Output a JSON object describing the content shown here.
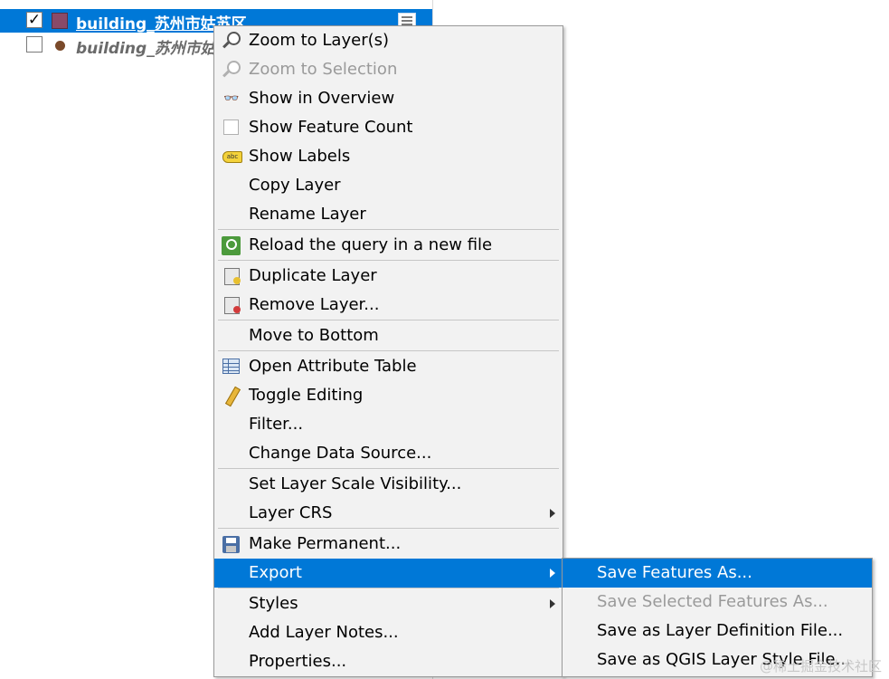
{
  "layers": [
    {
      "name": "building_苏州市姑苏区",
      "checked": true,
      "selected": true
    },
    {
      "name": "building_苏州市姑",
      "checked": false,
      "selected": false
    }
  ],
  "check_glyph": "✓",
  "menu": {
    "items": [
      {
        "label": "Zoom to Layer(s)",
        "icon": "zoom-icon"
      },
      {
        "label": "Zoom to Selection",
        "icon": "zoom-icon",
        "disabled": true
      },
      {
        "label": "Show in Overview",
        "icon": "overview-icon"
      },
      {
        "label": "Show Feature Count",
        "icon": "checkbox-icon"
      },
      {
        "label": "Show Labels",
        "icon": "labels-icon"
      },
      {
        "label": "Copy Layer"
      },
      {
        "label": "Rename Layer"
      },
      {
        "label": "Reload the query in a new file",
        "icon": "reload-query-icon"
      },
      {
        "label": "Duplicate Layer",
        "icon": "duplicate-icon"
      },
      {
        "label": "Remove Layer...",
        "icon": "remove-icon"
      },
      {
        "label": "Move to Bottom"
      },
      {
        "label": "Open Attribute Table",
        "icon": "attribute-table-icon"
      },
      {
        "label": "Toggle Editing",
        "icon": "pencil-icon"
      },
      {
        "label": "Filter..."
      },
      {
        "label": "Change Data Source..."
      },
      {
        "label": "Set Layer Scale Visibility..."
      },
      {
        "label": "Layer CRS",
        "submenu": true
      },
      {
        "label": "Make Permanent...",
        "icon": "save-icon"
      },
      {
        "label": "Export",
        "submenu": true,
        "highlighted": true
      },
      {
        "label": "Styles",
        "submenu": true
      },
      {
        "label": "Add Layer Notes..."
      },
      {
        "label": "Properties..."
      }
    ]
  },
  "export_submenu": {
    "items": [
      {
        "label": "Save Features As...",
        "highlighted": true
      },
      {
        "label": "Save Selected Features As...",
        "disabled": true
      },
      {
        "label": "Save as Layer Definition File..."
      },
      {
        "label": "Save as QGIS Layer Style File..."
      }
    ]
  },
  "watermark": "@稀土掘金技术社区",
  "colors": {
    "highlight": "#0078d7",
    "menu_bg": "#f2f2f2"
  }
}
